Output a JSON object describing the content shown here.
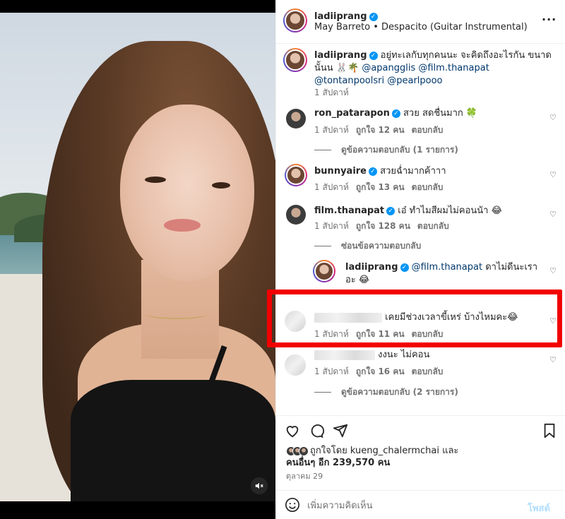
{
  "post": {
    "username": "ladiiprang",
    "audio": "May Barreto • Despacito (Guitar Instrumental)"
  },
  "caption": {
    "username": "ladiiprang",
    "text": "อยู่ทะเลกับทุกคนนะ จะคิดถึงอะไรกัน ขนาดนั้นน 🐰🌴",
    "mentions_line1": "@apangglis @film.thanapat",
    "mentions_line2": "@tontanpoolsri @pearlpooo",
    "time": "1 สัปดาห์"
  },
  "comments": [
    {
      "username": "ron_patarapon",
      "text": "สวย สดชื่นมาก 🍀",
      "time": "1 สัปดาห์",
      "likes": "ถูกใจ 12 คน",
      "reply": "ตอบกลับ",
      "view_replies": "ดูข้อความตอบกลับ (1 รายการ)"
    },
    {
      "username": "bunnyaire",
      "text": "สวยฉ่ำมากค้าาา",
      "time": "1 สัปดาห์",
      "likes": "ถูกใจ 13 คน",
      "reply": "ตอบกลับ"
    },
    {
      "username": "film.thanapat",
      "text": "เอ๋ ทำไมสีผมไม่คอนนัา 😂",
      "time": "1 สัปดาห์",
      "likes": "ถูกใจ 128 คน",
      "reply": "ตอบกลับ",
      "hide_replies": "ซ่อนข้อความตอบกลับ"
    },
    {
      "username": "ladiiprang",
      "mention": "@film.thanapat",
      "text": "ดาไม่ดีนะเราอะ 😂"
    },
    {
      "text": "เคยมีช่วงเวลาขี้เหร่ บ้างไหมคะ😂",
      "time": "1 สัปดาห์",
      "likes": "ถูกใจ 11 คน",
      "reply": "ตอบกลับ"
    },
    {
      "text": "งงนะ ไม่คอน",
      "time": "1 สัปดาห์",
      "likes": "ถูกใจ 16 คน",
      "reply": "ตอบกลับ",
      "view_replies": "ดูข้อความตอบกลับ (2 รายการ)"
    }
  ],
  "likes_summary": {
    "line1": "ถูกใจโดย kueng_chalermchai และ",
    "line2": "คนอื่นๆ อีก 239,570 คน",
    "date": "ตุลาคม 29"
  },
  "footer": {
    "placeholder": "เพิ่มความคิดเห็น",
    "post_label": "โพสต์"
  },
  "icons": {
    "more": "more-icon",
    "heart": "heart-icon",
    "comment": "comment-icon",
    "share": "share-icon",
    "save": "bookmark-icon",
    "emoji": "emoji-icon",
    "mute": "mute-icon"
  },
  "colors": {
    "highlight": "#f20000",
    "verified": "#0095f6",
    "link": "#00376b"
  }
}
